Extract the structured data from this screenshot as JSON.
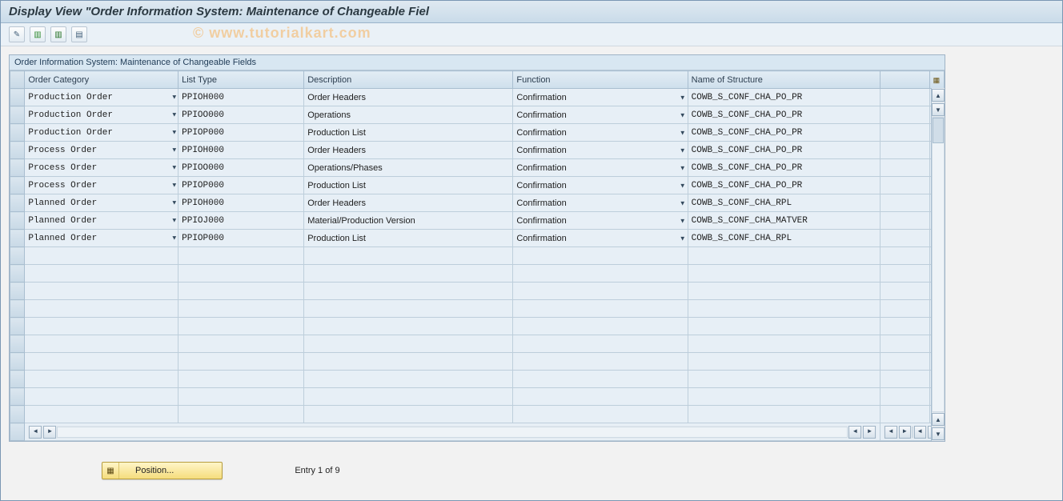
{
  "title": "Display View \"Order Information System: Maintenance of Changeable Fiel",
  "watermark": "© www.tutorialkart.com",
  "panel_header": "Order Information System: Maintenance of Changeable Fields",
  "columns": {
    "order_category": "Order Category",
    "list_type": "List Type",
    "description": "Description",
    "function": "Function",
    "structure": "Name of Structure"
  },
  "rows": [
    {
      "order_category": "Production Order",
      "list_type": "PPIOH000",
      "description": "Order Headers",
      "function": "Confirmation",
      "structure": "COWB_S_CONF_CHA_PO_PR"
    },
    {
      "order_category": "Production Order",
      "list_type": "PPIOO000",
      "description": "Operations",
      "function": "Confirmation",
      "structure": "COWB_S_CONF_CHA_PO_PR"
    },
    {
      "order_category": "Production Order",
      "list_type": "PPIOP000",
      "description": "Production List",
      "function": "Confirmation",
      "structure": "COWB_S_CONF_CHA_PO_PR"
    },
    {
      "order_category": "Process Order",
      "list_type": "PPIOH000",
      "description": "Order Headers",
      "function": "Confirmation",
      "structure": "COWB_S_CONF_CHA_PO_PR"
    },
    {
      "order_category": "Process Order",
      "list_type": "PPIOO000",
      "description": "Operations/Phases",
      "function": "Confirmation",
      "structure": "COWB_S_CONF_CHA_PO_PR"
    },
    {
      "order_category": "Process Order",
      "list_type": "PPIOP000",
      "description": "Production List",
      "function": "Confirmation",
      "structure": "COWB_S_CONF_CHA_PO_PR"
    },
    {
      "order_category": "Planned Order",
      "list_type": "PPIOH000",
      "description": "Order Headers",
      "function": "Confirmation",
      "structure": "COWB_S_CONF_CHA_RPL"
    },
    {
      "order_category": "Planned Order",
      "list_type": "PPIOJ000",
      "description": "Material/Production Version",
      "function": "Confirmation",
      "structure": "COWB_S_CONF_CHA_MATVER"
    },
    {
      "order_category": "Planned Order",
      "list_type": "PPIOP000",
      "description": "Production List",
      "function": "Confirmation",
      "structure": "COWB_S_CONF_CHA_RPL"
    }
  ],
  "empty_row_count": 10,
  "footer": {
    "position_label": "Position...",
    "entry_status": "Entry 1 of 9"
  },
  "icons": {
    "toggle": "pencil-glasses-icon",
    "sheet1": "sheet-green-icon",
    "sheet2": "sheet-dark-icon",
    "sheet3": "sheet-plain-icon",
    "config": "table-config-icon",
    "position": "position-icon"
  }
}
